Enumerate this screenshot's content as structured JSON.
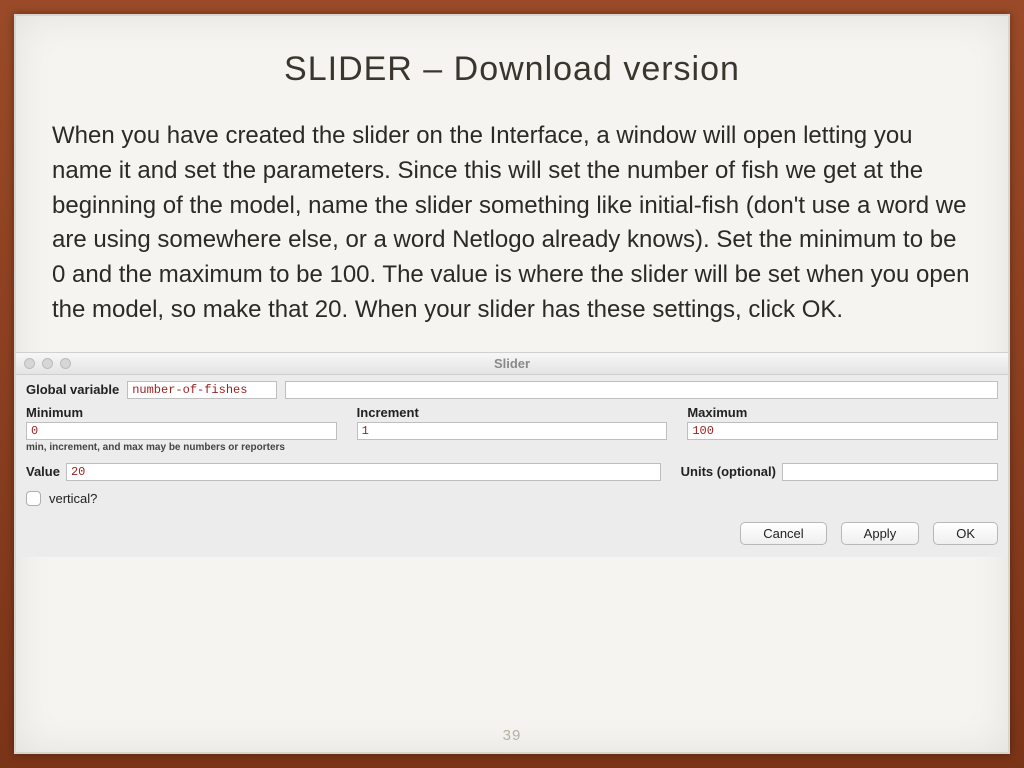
{
  "slide": {
    "title": "SLIDER – Download version",
    "body": "When you have created the slider on the Interface, a window will open letting you name it and set the parameters.  Since this will set the number of fish we get at the beginning of the model, name the slider something like initial-fish (don't use a word we are using somewhere else, or a word Netlogo already knows).  Set the minimum to be 0 and the maximum to be 100.  The value is where the slider will be set when you open the model, so make that 20.  When your slider has these settings, click OK.",
    "page_number": "39"
  },
  "dialog": {
    "window_title": "Slider",
    "global_variable_label": "Global variable",
    "global_variable_value": "number-of-fishes",
    "minimum_label": "Minimum",
    "minimum_value": "0",
    "increment_label": "Increment",
    "increment_value": "1",
    "maximum_label": "Maximum",
    "maximum_value": "100",
    "hint": "min, increment, and max may be numbers or reporters",
    "value_label": "Value",
    "value_value": "20",
    "units_label": "Units (optional)",
    "units_value": "",
    "vertical_label": "vertical?",
    "buttons": {
      "cancel": "Cancel",
      "apply": "Apply",
      "ok": "OK"
    }
  }
}
